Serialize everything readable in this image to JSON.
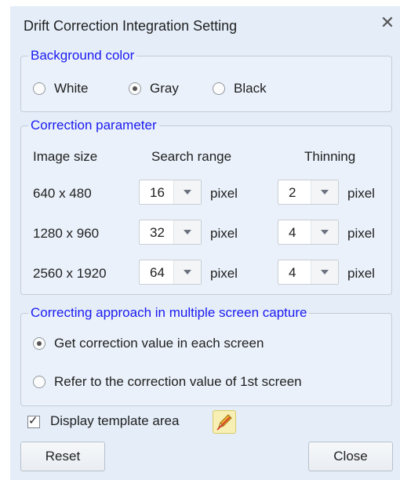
{
  "dialog": {
    "title": "Drift Correction Integration Setting",
    "close_glyph": "✕"
  },
  "background_color": {
    "legend": "Background color",
    "options": [
      "White",
      "Gray",
      "Black"
    ],
    "selected": "Gray"
  },
  "correction_parameter": {
    "legend": "Correction parameter",
    "headers": {
      "image_size": "Image size",
      "search_range": "Search range",
      "thinning": "Thinning"
    },
    "unit": "pixel",
    "rows": [
      {
        "image_size": "640 x 480",
        "search_range": "16",
        "thinning": "2"
      },
      {
        "image_size": "1280 x 960",
        "search_range": "32",
        "thinning": "4"
      },
      {
        "image_size": "2560 x 1920",
        "search_range": "64",
        "thinning": "4"
      }
    ]
  },
  "approach": {
    "legend": "Correcting approach in multiple screen capture",
    "options": [
      "Get correction value in each screen",
      "Refer to the correction value of 1st screen"
    ],
    "selected": "Get correction value in each screen"
  },
  "display_template": {
    "label": "Display template area",
    "checked": true,
    "edit_icon": "pencil-icon"
  },
  "buttons": {
    "reset": "Reset",
    "close": "Close"
  },
  "colors": {
    "legend_text": "#1a1af0",
    "dialog_bg": "#e4edf8"
  }
}
